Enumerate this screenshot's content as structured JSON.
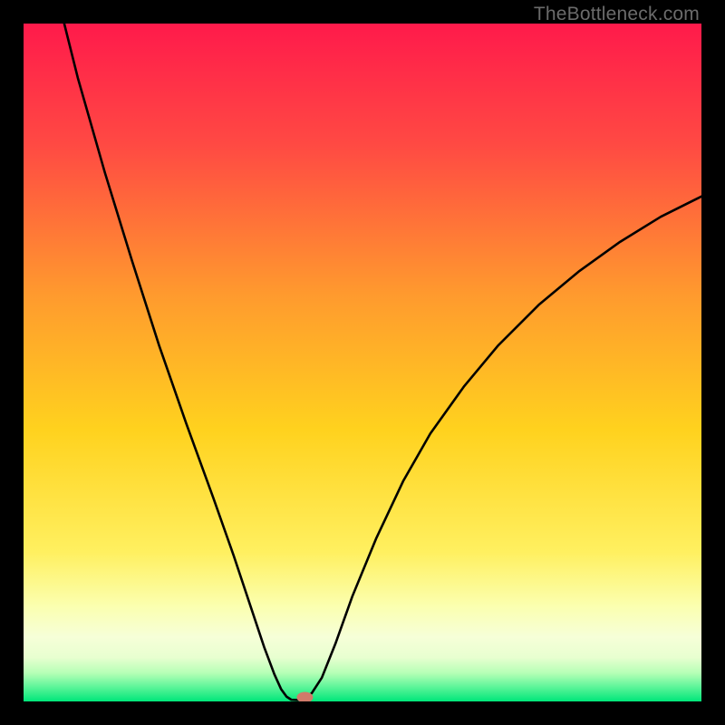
{
  "watermark": "TheBottleneck.com",
  "chart_data": {
    "type": "line",
    "title": "",
    "xlabel": "",
    "ylabel": "",
    "xlim": [
      0,
      100
    ],
    "ylim": [
      0,
      100
    ],
    "grid": false,
    "legend": false,
    "annotations": [],
    "background_gradient_stops": [
      {
        "offset": 0.0,
        "color": "#ff1a4b"
      },
      {
        "offset": 0.18,
        "color": "#ff4a43"
      },
      {
        "offset": 0.4,
        "color": "#ff9a2e"
      },
      {
        "offset": 0.6,
        "color": "#ffd21e"
      },
      {
        "offset": 0.78,
        "color": "#fff060"
      },
      {
        "offset": 0.86,
        "color": "#fbffb0"
      },
      {
        "offset": 0.905,
        "color": "#f6ffd8"
      },
      {
        "offset": 0.935,
        "color": "#e8ffd0"
      },
      {
        "offset": 0.958,
        "color": "#b6ffb6"
      },
      {
        "offset": 0.978,
        "color": "#60f59a"
      },
      {
        "offset": 1.0,
        "color": "#00e67a"
      }
    ],
    "curve_color": "#000000",
    "curve_width": 2.6,
    "curve_points": [
      {
        "x": 6.0,
        "y": 100.0
      },
      {
        "x": 8.0,
        "y": 92.0
      },
      {
        "x": 12.0,
        "y": 78.0
      },
      {
        "x": 16.0,
        "y": 65.0
      },
      {
        "x": 20.0,
        "y": 52.5
      },
      {
        "x": 24.0,
        "y": 41.0
      },
      {
        "x": 28.0,
        "y": 30.0
      },
      {
        "x": 31.0,
        "y": 21.5
      },
      {
        "x": 33.5,
        "y": 14.0
      },
      {
        "x": 35.5,
        "y": 8.0
      },
      {
        "x": 37.0,
        "y": 4.0
      },
      {
        "x": 38.0,
        "y": 1.8
      },
      {
        "x": 38.8,
        "y": 0.7
      },
      {
        "x": 39.5,
        "y": 0.25
      },
      {
        "x": 40.5,
        "y": 0.2
      },
      {
        "x": 41.5,
        "y": 0.4
      },
      {
        "x": 42.5,
        "y": 1.2
      },
      {
        "x": 44.0,
        "y": 3.5
      },
      {
        "x": 46.0,
        "y": 8.5
      },
      {
        "x": 48.5,
        "y": 15.5
      },
      {
        "x": 52.0,
        "y": 24.0
      },
      {
        "x": 56.0,
        "y": 32.5
      },
      {
        "x": 60.0,
        "y": 39.5
      },
      {
        "x": 65.0,
        "y": 46.5
      },
      {
        "x": 70.0,
        "y": 52.5
      },
      {
        "x": 76.0,
        "y": 58.5
      },
      {
        "x": 82.0,
        "y": 63.5
      },
      {
        "x": 88.0,
        "y": 67.8
      },
      {
        "x": 94.0,
        "y": 71.5
      },
      {
        "x": 100.0,
        "y": 74.5
      }
    ],
    "marker": {
      "x": 41.5,
      "y": 0.6,
      "rx": 1.2,
      "ry": 0.8,
      "color": "#d07a6a"
    }
  }
}
